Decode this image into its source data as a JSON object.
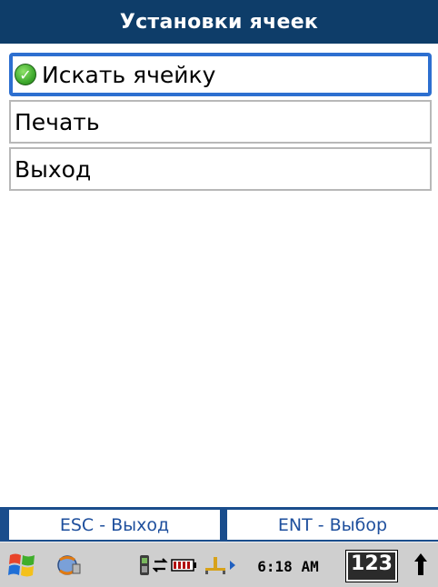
{
  "window": {
    "title": "Установки ячеек"
  },
  "menu": {
    "items": [
      {
        "label": "Искать ячейку",
        "selected": true,
        "icon": "green-check-icon"
      },
      {
        "label": "Печать",
        "selected": false
      },
      {
        "label": "Выход",
        "selected": false
      }
    ]
  },
  "softkeys": {
    "left": "ESC - Выход",
    "right": "ENT - Выбор"
  },
  "taskbar": {
    "start_icon": "windows-flag-icon",
    "app_icon": "sync-globe-icon",
    "status_icons": [
      "phone-signal-icon",
      "sync-arrows-icon",
      "battery-icon",
      "network-icon",
      "expand-arrow-icon"
    ],
    "clock": "6:18 AM",
    "input_mode": "123",
    "up_arrow_icon": "up-arrow-icon"
  },
  "colors": {
    "title_bg": "#0e3d69",
    "selection_border": "#2d6fd0",
    "softkey_text": "#1e4f9d",
    "taskbar_bg": "#cfcfcf"
  }
}
